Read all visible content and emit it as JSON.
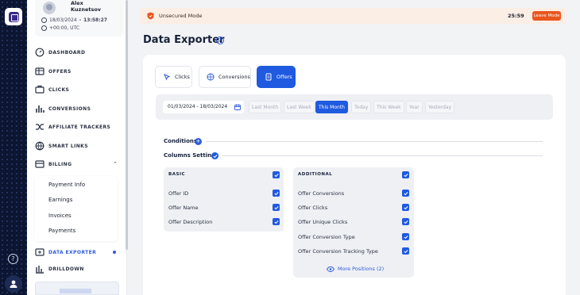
{
  "profile": {
    "name_line1": "Alex",
    "name_line2": "Kuznetsov",
    "datetime_date": "18/03/2024",
    "datetime_time": "13:58:27",
    "timezone": "+00:00, UTC"
  },
  "sidebar": {
    "items": [
      {
        "label": "DASHBOARD",
        "icon": "dashboard-icon"
      },
      {
        "label": "OFFERS",
        "icon": "offers-icon"
      },
      {
        "label": "CLICKS",
        "icon": "clicks-icon"
      },
      {
        "label": "CONVERSIONS",
        "icon": "bar-chart-icon"
      },
      {
        "label": "AFFILIATE TRACKERS",
        "icon": "shuffle-icon"
      },
      {
        "label": "SMART LINKS",
        "icon": "globe-icon"
      },
      {
        "label": "BILLING",
        "icon": "wallet-icon"
      },
      {
        "label": "DATA EXPORTER",
        "icon": "export-icon"
      },
      {
        "label": "DRILLDOWN",
        "icon": "layers-icon"
      }
    ],
    "billing_sub": [
      "Payment Info",
      "Earnings",
      "Invoices",
      "Payments"
    ]
  },
  "banner": {
    "text": "Unsecured Mode",
    "timer": "25:59",
    "leave_label": "Leave Mode"
  },
  "page": {
    "title": "Data Exporter",
    "help": "?"
  },
  "tabs": [
    {
      "label": "Clicks",
      "icon": "cursor-icon"
    },
    {
      "label": "Conversions",
      "icon": "target-icon"
    },
    {
      "label": "Offers",
      "icon": "document-icon"
    }
  ],
  "date_filter": {
    "range": "01/03/2024 - 18/03/2024",
    "periods": [
      "Last Month",
      "Last Week",
      "This Month",
      "Today",
      "This Week",
      "Year",
      "Yesterday"
    ],
    "selected": "This Month"
  },
  "sections": {
    "conditions": "Conditions",
    "columns_settings": "Columns Settings"
  },
  "basic": {
    "header": "BASIC",
    "rows": [
      "Offer ID",
      "Offer Name",
      "Offer Description"
    ]
  },
  "additional": {
    "header": "ADDITIONAL",
    "rows": [
      "Offer Conversions",
      "Offer Clicks",
      "Offer Unique Clicks",
      "Offer Conversion Type",
      "Offer Conversion Tracking Type"
    ],
    "more_label": "More Positions (2)"
  },
  "colors": {
    "accent": "#1f5ae0",
    "rail": "#0c1531",
    "warning": "#e9561e"
  }
}
